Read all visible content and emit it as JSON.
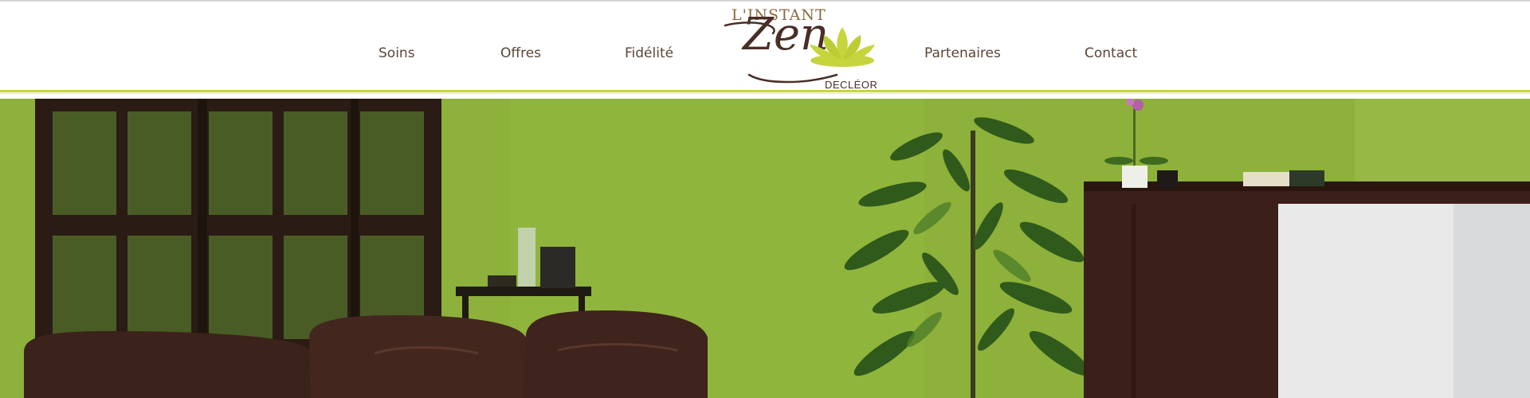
{
  "nav": {
    "items": [
      {
        "label": "Soins"
      },
      {
        "label": "Offres"
      },
      {
        "label": "Fidélité"
      },
      {
        "label": "Partenaires"
      },
      {
        "label": "Contact"
      }
    ]
  },
  "logo": {
    "small_text": "L'INSTANT",
    "big_text": "Zen",
    "brand_text": "DECLÉOR",
    "accent_color": "#c6d53e",
    "text_color": "#4a2e26"
  },
  "hero": {
    "image": "spa-waiting-room-photo"
  },
  "colors": {
    "nav_text": "#5b4638",
    "header_line": "#c6d53e",
    "wall_green": "#8fb23a"
  }
}
